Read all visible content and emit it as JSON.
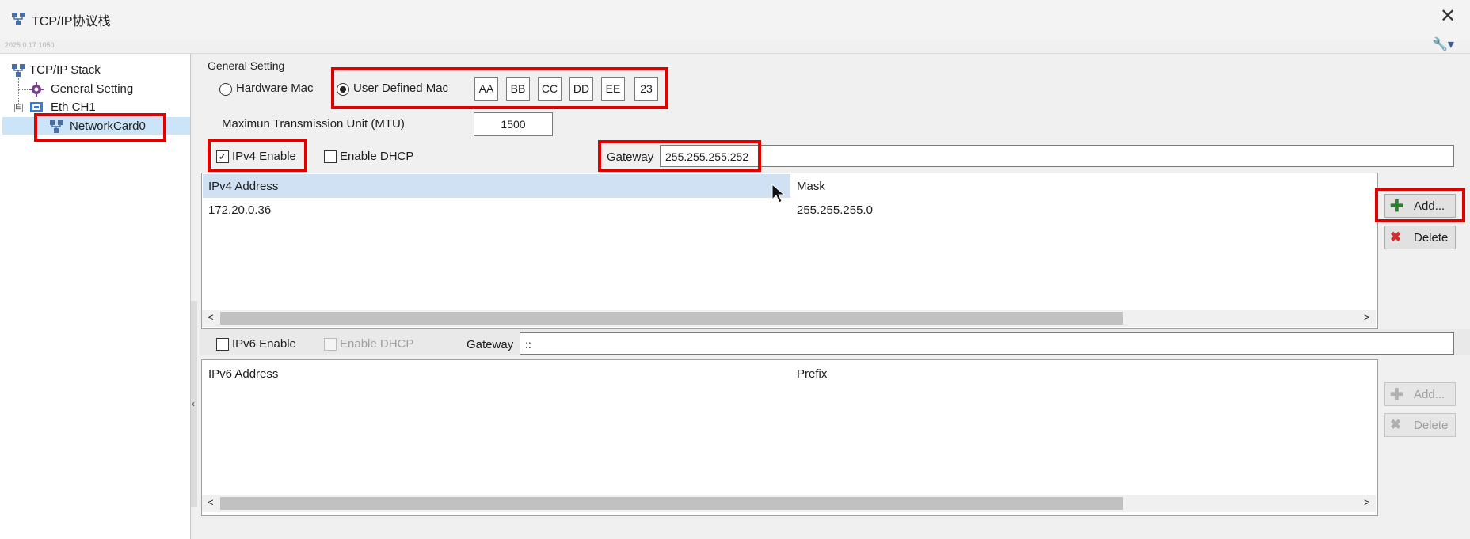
{
  "window": {
    "title": "TCP/IP协议栈",
    "version": "2025.0.17.1050",
    "close_label": "✕",
    "settings_label": "🔧▾"
  },
  "tree": {
    "root": "TCP/IP Stack",
    "general": "General Setting",
    "eth": "Eth CH1",
    "card": "NetworkCard0",
    "expander": "⊟"
  },
  "general": {
    "group_label": "General Setting",
    "hardware_mac": "Hardware Mac",
    "user_defined_mac": "User Defined Mac",
    "mac_bytes": [
      "AA",
      "BB",
      "CC",
      "DD",
      "EE",
      "23"
    ],
    "mtu_label": "Maximun Transmission Unit (MTU)",
    "mtu_value": "1500"
  },
  "ipv4": {
    "enable_label": "IPv4 Enable",
    "enable_checked": true,
    "dhcp_label": "Enable DHCP",
    "dhcp_checked": false,
    "gateway_label": "Gateway",
    "gateway_value": "255.255.255.252",
    "columns": [
      "IPv4 Address",
      "Mask"
    ],
    "rows": [
      [
        "172.20.0.36",
        "255.255.255.0"
      ]
    ],
    "add_label": "Add...",
    "delete_label": "Delete"
  },
  "ipv6": {
    "enable_label": "IPv6 Enable",
    "enable_checked": false,
    "dhcp_label": "Enable DHCP",
    "gateway_label": "Gateway",
    "gateway_value": "::",
    "columns": [
      "IPv6 Address",
      "Prefix"
    ],
    "add_label": "Add...",
    "delete_label": "Delete"
  },
  "scroll": {
    "left": "<",
    "right": ">"
  },
  "splitter_arrow": "‹",
  "colors": {
    "highlight": "#e00000",
    "selection": "#cce4f7",
    "add": "#2e7d32",
    "delete": "#d32f2f"
  },
  "icons": [
    "network-stack-icon",
    "gear-icon",
    "ethernet-icon",
    "network-card-icon",
    "wrench-icon",
    "plus-icon",
    "cross-icon"
  ]
}
